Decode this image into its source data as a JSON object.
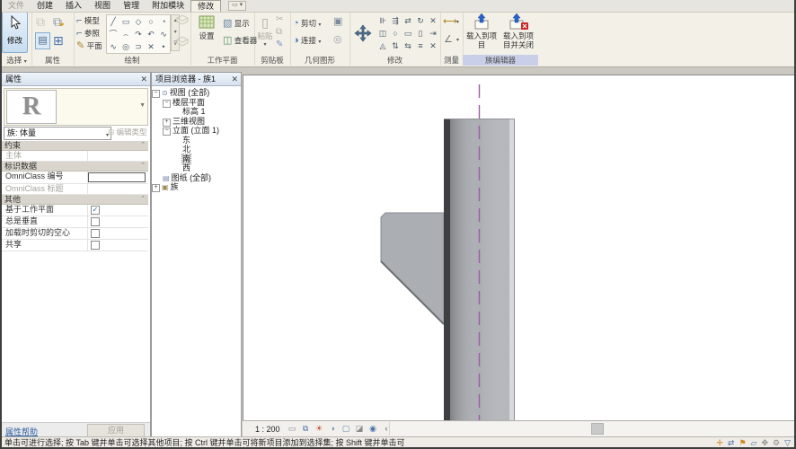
{
  "menubar": {
    "tabs": [
      "文件",
      "创建",
      "插入",
      "视图",
      "管理",
      "附加模块",
      "修改"
    ],
    "selected_tab": "修改"
  },
  "ribbon": {
    "select": {
      "modify_button": "修改",
      "panel_label": "选择"
    },
    "properties_panel": {
      "panel_label": "属性"
    },
    "draw": {
      "panel_label": "绘制",
      "model": "模型",
      "reference": "参照",
      "plane": "平面",
      "tools_row1": [
        "╱",
        "▭",
        "◇",
        "○",
        "◔"
      ],
      "tools_row2": [
        "⌒",
        "⌢",
        "↷",
        "↶",
        "∿"
      ],
      "tools_row3": [
        "∿",
        "◎",
        "⊃",
        "✕",
        "•"
      ]
    },
    "work_plane": {
      "panel_label": "工作平面",
      "set": "设置",
      "show": "显示",
      "viewer": "查看器"
    },
    "clipboard": {
      "panel_label": "剪贴板",
      "paste": "粘贴"
    },
    "geometry": {
      "panel_label": "几何图形",
      "cut": "剪切",
      "join": "连接"
    },
    "modify": {
      "panel_label": "修改",
      "tools_row1": [
        "⊪",
        "⇶",
        "⇄",
        "↻",
        "✕"
      ],
      "tools_row2": [
        "◫",
        "○",
        "▭",
        "▯",
        "⇥"
      ],
      "tools_row3": [
        "◬",
        "⇅",
        "⇆",
        "≡",
        "✕"
      ]
    },
    "measure": {
      "panel_label": "测量"
    },
    "family_editor": {
      "panel_label": "族编辑器",
      "load": "载入到项目",
      "load_close": "载入到项目并关闭"
    }
  },
  "properties": {
    "title": "属性",
    "family_label": "族: 体量",
    "edit_type_button": "编辑类型",
    "sections": [
      {
        "header": "约束",
        "rows": [
          {
            "label": "主体",
            "value": ""
          }
        ]
      },
      {
        "header": "标识数据",
        "rows": [
          {
            "label": "OmniClass 编号",
            "value": ""
          },
          {
            "label": "OmniClass 标题",
            "value": ""
          }
        ]
      },
      {
        "header": "其他",
        "rows": [
          {
            "label": "基于工作平面",
            "checked": true
          },
          {
            "label": "总是垂直",
            "checked": false
          },
          {
            "label": "加载时剪切的空心",
            "checked": false
          },
          {
            "label": "共享",
            "checked": false
          }
        ]
      }
    ],
    "help_link": "属性帮助",
    "apply_button": "应用"
  },
  "browser": {
    "title": "项目浏览器 - 族1",
    "tree": [
      {
        "label": "视图 (全部)",
        "expander": "−"
      },
      {
        "label": "楼层平面",
        "expander": "−"
      },
      {
        "label": "标高 1"
      },
      {
        "label": "三维视图",
        "expander": "+"
      },
      {
        "label": "立面 (立面 1)",
        "expander": "−"
      },
      {
        "label": "东"
      },
      {
        "label": "北"
      },
      {
        "label": "南",
        "selected": true
      },
      {
        "label": "西"
      },
      {
        "label": "图纸 (全部)"
      },
      {
        "label": "族",
        "expander": "+"
      }
    ]
  },
  "viewbar": {
    "scale": "1 : 200"
  },
  "statusbar": {
    "message": "单击可进行选择; 按 Tab 键并单击可选择其他项目; 按 Ctrl 键并单击可将新项目添加到选择集; 按 Shift 键并单击可"
  },
  "canvas": {
    "centerline_color": "#9c5ca6",
    "column_color": "#abaeb3",
    "column_dark_edge": "#3d3f42",
    "column_light_edge": "#d7d9dc"
  }
}
